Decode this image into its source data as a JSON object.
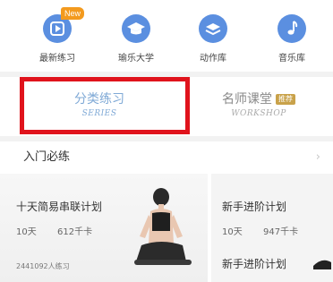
{
  "shortcuts": [
    {
      "label": "最新练习",
      "icon": "play-icon",
      "badge": "New",
      "color": "#5b8fe0"
    },
    {
      "label": "瑜乐大学",
      "icon": "graduation-cap-icon",
      "color": "#5b8fe0"
    },
    {
      "label": "动作库",
      "icon": "layers-icon",
      "color": "#5b8fe0"
    },
    {
      "label": "音乐库",
      "icon": "music-note-icon",
      "color": "#5b8fe0"
    }
  ],
  "tabs": [
    {
      "title": "分类练习",
      "subtitle": "SERIES",
      "active": true
    },
    {
      "title": "名师课堂",
      "subtitle": "WORKSHOP",
      "badge": "推荐"
    }
  ],
  "section": {
    "title": "入门必练",
    "chevron": "›"
  },
  "cards": [
    {
      "title": "十天简易串联计划",
      "days": "10天",
      "calories": "612千卡",
      "participants": "2441092人练习"
    },
    {
      "title": "新手进阶计划",
      "days": "10天",
      "calories": "947千卡",
      "title_repeat": "新手进阶计划"
    }
  ],
  "colors": {
    "accent": "#5b8fe0",
    "tab_active": "#7fa9d6",
    "highlight": "#e0131c",
    "new_badge": "#f39a1e"
  }
}
